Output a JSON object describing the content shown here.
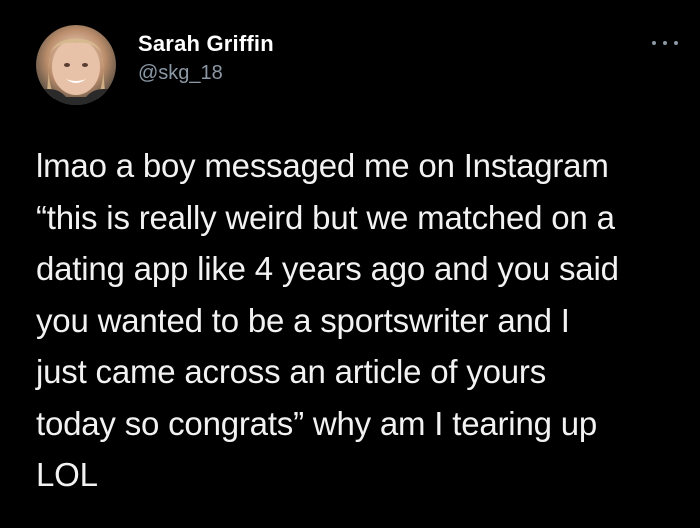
{
  "tweet": {
    "author": {
      "name": "Sarah Griffin",
      "handle": "@skg_18",
      "avatar_icon": "profile-photo"
    },
    "more_icon": "more-options-icon",
    "text": "lmao a boy messaged me on Instagram\n“this is really weird but we matched on a\ndating app like 4 years ago and you said\nyou wanted to be a sportswriter and I\njust came across an article of yours\ntoday so congrats” why am I tearing up\nLOL"
  },
  "colors": {
    "background": "#000000",
    "text": "#f2f2f2",
    "secondary_text": "#8b98a5"
  }
}
